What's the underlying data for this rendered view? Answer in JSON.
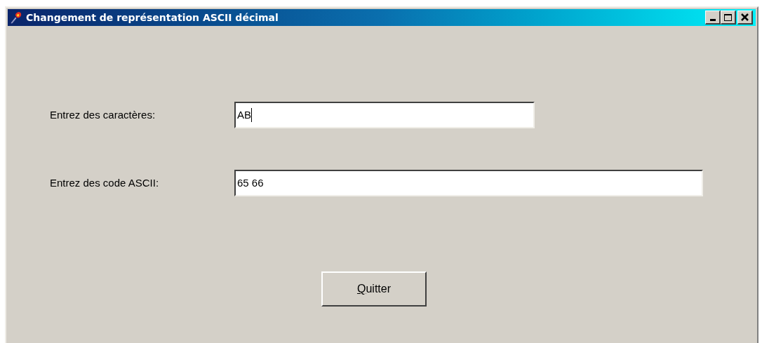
{
  "window": {
    "title": "Changement de représentation ASCII décimal",
    "controls": [
      {
        "kind": "minimize"
      },
      {
        "kind": "maximize"
      },
      {
        "kind": "close"
      }
    ]
  },
  "fields": [
    {
      "label": "Entrez des caractères:",
      "value": "AB",
      "focused": true
    },
    {
      "label": "Entrez des code ASCII:",
      "value": "65 66",
      "focused": false
    }
  ],
  "button": {
    "label": "Quitter",
    "mnemonic_first_letter": true
  }
}
